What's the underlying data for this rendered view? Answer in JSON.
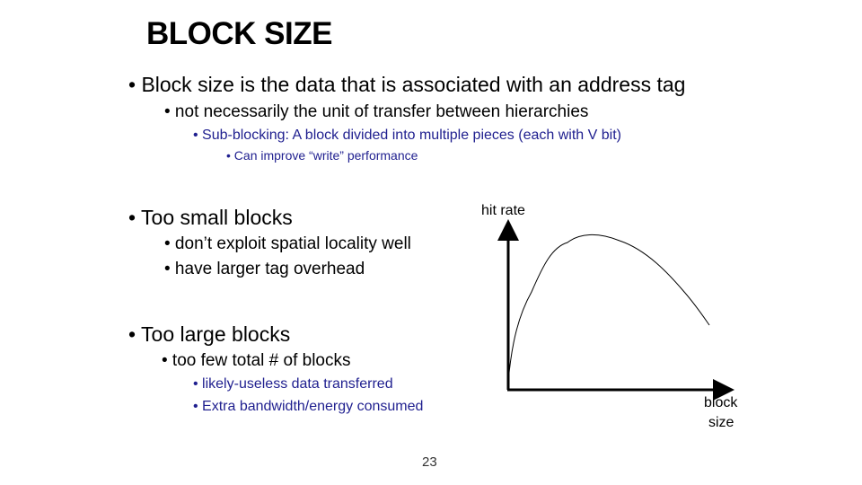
{
  "slide": {
    "title": "BLOCK SIZE",
    "bullets": [
      "• Block size is the data that is associated with an address tag",
      "• not necessarily the unit of transfer between hierarchies",
      "• Sub-blocking: A block divided into multiple pieces (each with V bit)",
      "• Can improve “write” performance",
      "• Too small blocks",
      "• don’t exploit spatial locality well",
      "• have larger tag overhead",
      "• Too large blocks",
      "• too few total # of blocks",
      "• likely-useless data transferred",
      "• Extra bandwidth/energy consumed"
    ],
    "page_number": "23",
    "text_color_sub": "#1f1f8f"
  },
  "diagram": {
    "ylabel": "hit rate",
    "xlabel_line1": "block",
    "xlabel_line2": "size"
  }
}
